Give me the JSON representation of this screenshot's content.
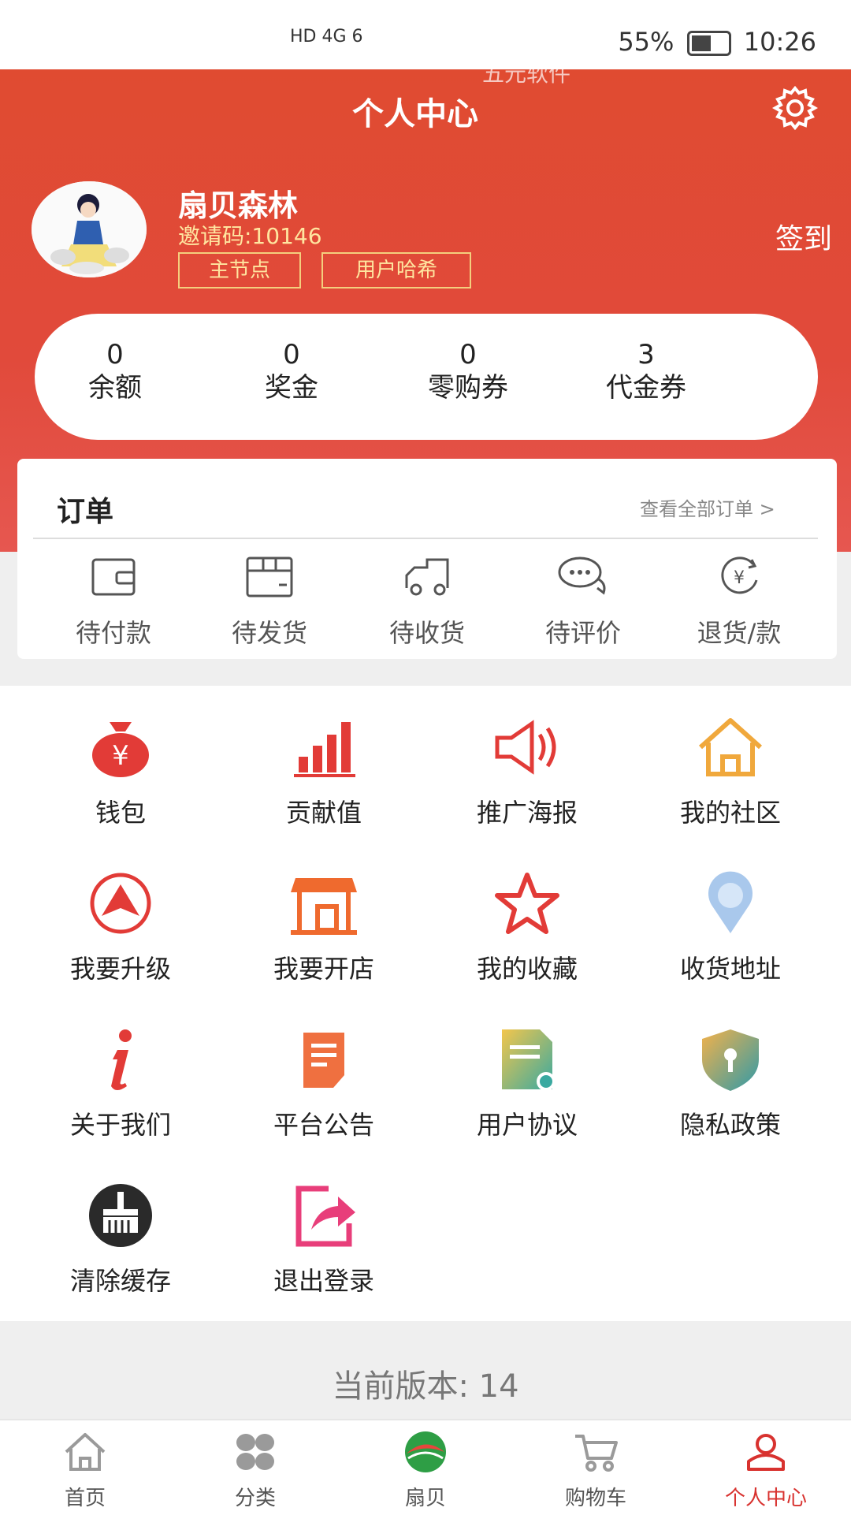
{
  "status_bar": {
    "signal": "HD 4G 6",
    "battery": "55%",
    "time": "10:26"
  },
  "header": {
    "watermark": "五元软件",
    "title": "个人中心",
    "user": {
      "name": "扇贝森林",
      "invite_code": "邀请码:10146",
      "tags": [
        "主节点",
        "用户哈希"
      ]
    },
    "checkin": "签到"
  },
  "stats": [
    {
      "value": "0",
      "label": "余额"
    },
    {
      "value": "0",
      "label": "奖金"
    },
    {
      "value": "0",
      "label": "零购券"
    },
    {
      "value": "3",
      "label": "代金券"
    }
  ],
  "orders": {
    "title": "订单",
    "view_all": "查看全部订单 >",
    "items": [
      {
        "label": "待付款",
        "icon": "wallet-icon"
      },
      {
        "label": "待发货",
        "icon": "box-icon"
      },
      {
        "label": "待收货",
        "icon": "truck-icon"
      },
      {
        "label": "待评价",
        "icon": "comment-icon"
      },
      {
        "label": "退货/款",
        "icon": "refund-icon"
      }
    ]
  },
  "menu": [
    {
      "label": "钱包",
      "icon": "money-bag-icon"
    },
    {
      "label": "贡献值",
      "icon": "bar-chart-icon"
    },
    {
      "label": "推广海报",
      "icon": "megaphone-icon"
    },
    {
      "label": "我的社区",
      "icon": "home-icon"
    },
    {
      "label": "我要升级",
      "icon": "upgrade-icon"
    },
    {
      "label": "我要开店",
      "icon": "store-icon"
    },
    {
      "label": "我的收藏",
      "icon": "star-icon"
    },
    {
      "label": "收货地址",
      "icon": "location-pin-icon"
    },
    {
      "label": "关于我们",
      "icon": "info-icon"
    },
    {
      "label": "平台公告",
      "icon": "notice-icon"
    },
    {
      "label": "用户协议",
      "icon": "agreement-icon"
    },
    {
      "label": "隐私政策",
      "icon": "shield-lock-icon"
    },
    {
      "label": "清除缓存",
      "icon": "broom-icon"
    },
    {
      "label": "退出登录",
      "icon": "logout-icon"
    }
  ],
  "version": "当前版本:  14",
  "tabs": [
    {
      "label": "首页",
      "icon": "home-tab-icon",
      "active": false
    },
    {
      "label": "分类",
      "icon": "category-icon",
      "active": false
    },
    {
      "label": "扇贝",
      "icon": "shanbei-logo-icon",
      "active": false
    },
    {
      "label": "购物车",
      "icon": "cart-icon",
      "active": false
    },
    {
      "label": "个人中心",
      "icon": "user-icon",
      "active": true
    }
  ],
  "colors": {
    "brand_red": "#e14a3b",
    "gold": "#f4cf7e",
    "active_tab": "#d8322f"
  }
}
